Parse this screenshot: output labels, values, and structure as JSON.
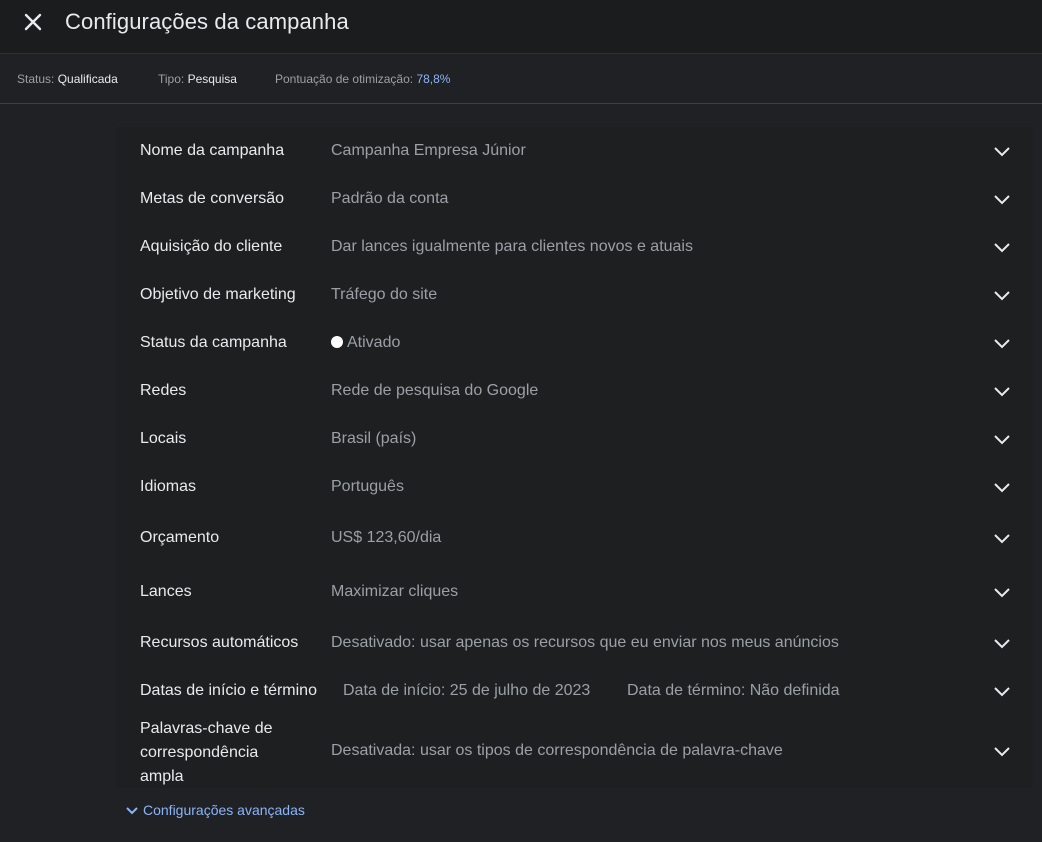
{
  "header": {
    "title": "Configurações da campanha"
  },
  "statusbar": {
    "status_label": "Status:",
    "status_value": "Qualificada",
    "type_label": "Tipo:",
    "type_value": "Pesquisa",
    "score_label": "Pontuação de otimização:",
    "score_value": "78,8%"
  },
  "settings": [
    {
      "label": "Nome da campanha",
      "value": "Campanha Empresa Júnior"
    },
    {
      "label": "Metas de conversão",
      "value": "Padrão da conta"
    },
    {
      "label": "Aquisição do cliente",
      "value": "Dar lances igualmente para clientes novos e atuais"
    },
    {
      "label": "Objetivo de marketing",
      "value": "Tráfego do site"
    },
    {
      "label": "Status da campanha",
      "value": "Ativado"
    },
    {
      "label": "Redes",
      "value": "Rede de pesquisa do Google"
    },
    {
      "label": "Locais",
      "value": "Brasil (país)"
    },
    {
      "label": "Idiomas",
      "value": "Português"
    },
    {
      "label": "Orçamento",
      "value": "US$ 123,60/dia"
    },
    {
      "label": "Lances",
      "value": "Maximizar cliques"
    },
    {
      "label": "Recursos automáticos",
      "value": "Desativado: usar apenas os recursos que eu enviar nos meus anúncios"
    },
    {
      "label": "Datas de início e término",
      "start": "Data de início: 25 de julho de 2023",
      "end": "Data de término: Não definida"
    },
    {
      "label_lines": [
        "Palavras-chave de",
        "correspondência",
        "ampla"
      ],
      "value": "Desativada: usar os tipos de correspondência de palavra-chave"
    }
  ],
  "advanced": {
    "label": "Configurações avançadas"
  },
  "colors": {
    "accent": "#8ab4f8",
    "background": "#202124",
    "panel": "#1e1f21"
  }
}
